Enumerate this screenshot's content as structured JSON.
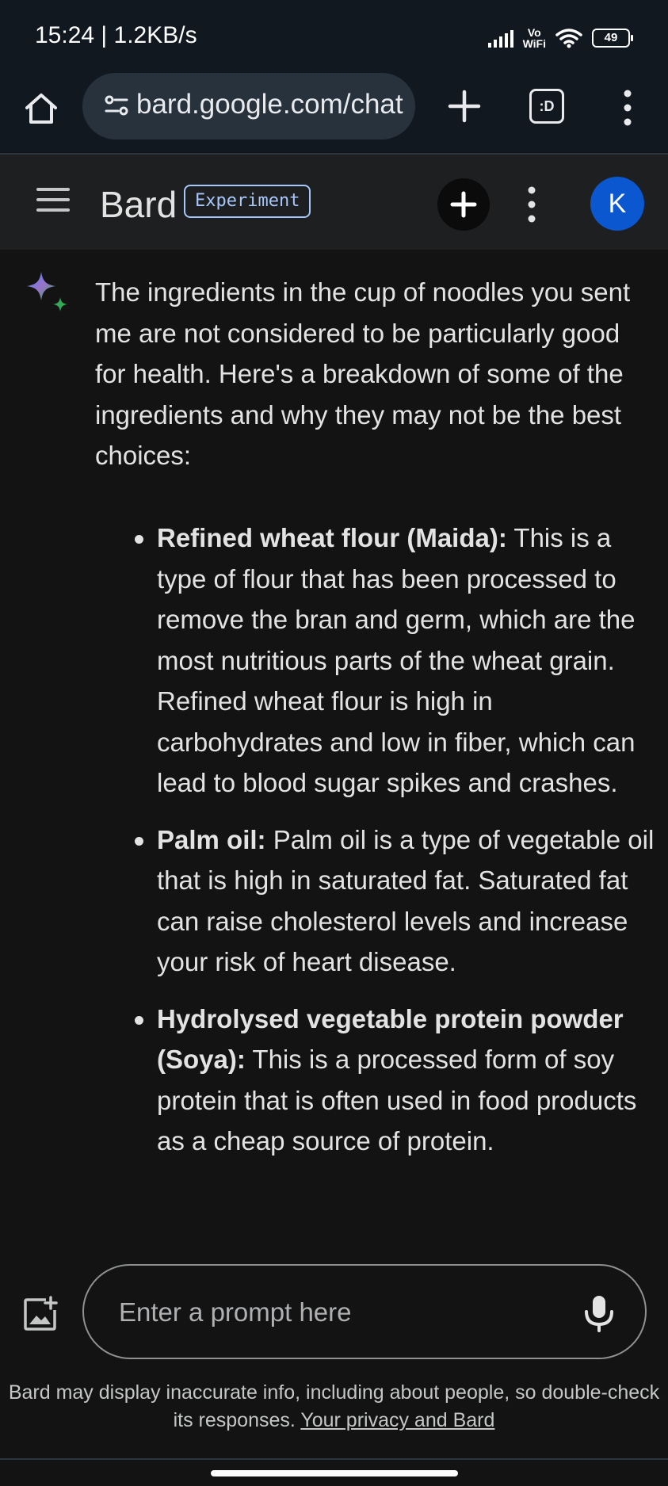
{
  "status_bar": {
    "time": "15:24 | 1.2KB/s",
    "vowifi_top": "Vo",
    "vowifi_bottom": "WiFi",
    "battery": "49"
  },
  "browser": {
    "url": "bard.google.com/chat",
    "tabs_label": ":D"
  },
  "app_bar": {
    "title": "Bard",
    "badge": "Experiment",
    "avatar_letter": "K"
  },
  "response": {
    "intro": "The ingredients in the cup of noodles you sent me are not considered to be particularly good for health. Here's a breakdown of some of the ingredients and why they may not be the best choices:",
    "items": [
      {
        "title": "Refined wheat flour (Maida):",
        "text": " This is a type of flour that has been processed to remove the bran and germ, which are the most nutritious parts of the wheat grain. Refined wheat flour is high in carbohydrates and low in fiber, which can lead to blood sugar spikes and crashes."
      },
      {
        "title": "Palm oil:",
        "text": " Palm oil is a type of vegetable oil that is high in saturated fat. Saturated fat can raise cholesterol levels and increase your risk of heart disease."
      },
      {
        "title": "Hydrolysed vegetable protein powder (Soya):",
        "text": " This is a processed form of soy protein that is often used in food products as a cheap source of protein."
      }
    ]
  },
  "input": {
    "placeholder": "Enter a prompt here"
  },
  "footer": {
    "disclaimer": "Bard may display inaccurate info, including about people, so double-check its responses. ",
    "privacy_link": "Your privacy and Bard"
  },
  "colors": {
    "background": "#131314",
    "app_bar": "#1e1f20",
    "browser_bar": "#121820",
    "accent": "#a8c7fa",
    "avatar": "#0b57d0"
  }
}
